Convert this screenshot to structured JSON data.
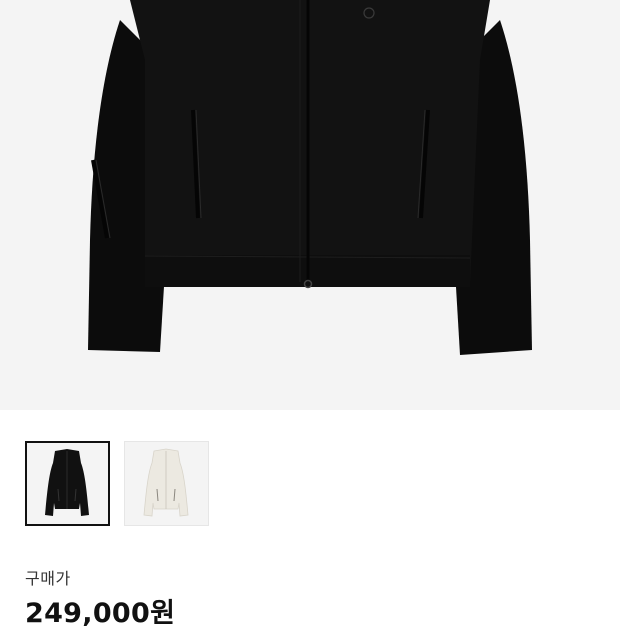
{
  "product": {
    "main_image_icon": "black-jacket-photo",
    "thumbnails": [
      {
        "name": "black-jacket-thumbnail",
        "color": "#111111",
        "selected": true
      },
      {
        "name": "ivory-jacket-thumbnail",
        "color": "#ece9e1",
        "selected": false
      }
    ],
    "price_label": "구매가",
    "price_value": "249,000원"
  }
}
